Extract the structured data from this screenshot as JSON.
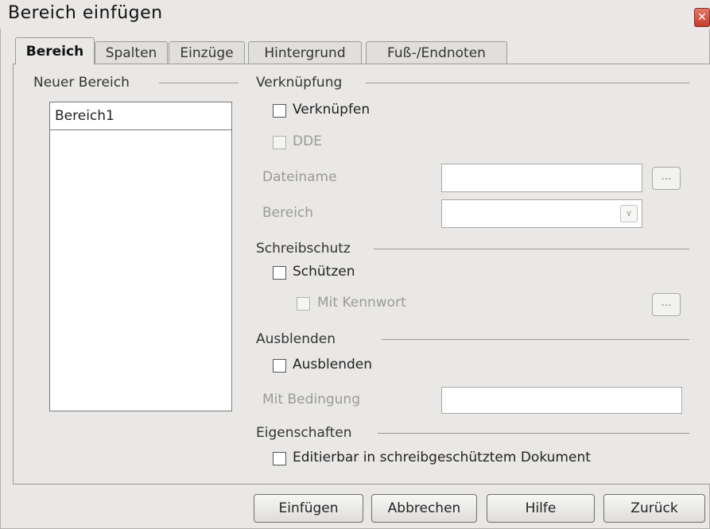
{
  "window": {
    "title": "Bereich einfügen",
    "close_glyph": "✕"
  },
  "tabs": [
    {
      "label": "Bereich",
      "active": true
    },
    {
      "label": "Spalten"
    },
    {
      "label": "Einzüge"
    },
    {
      "label": "Hintergrund"
    },
    {
      "label": "Fuß-/Endnoten"
    }
  ],
  "new_section": {
    "group_label": "Neuer Bereich",
    "name_value": "Bereich1"
  },
  "link": {
    "group_label": "Verknüpfung",
    "link_checkbox": "Verknüpfen",
    "dde_checkbox": "DDE",
    "filename_label": "Dateiname",
    "section_label": "Bereich",
    "browse_label": "..."
  },
  "write_protection": {
    "group_label": "Schreibschutz",
    "protect_checkbox": "Schützen",
    "password_checkbox": "Mit Kennwort",
    "password_button": "..."
  },
  "hide": {
    "group_label": "Ausblenden",
    "hide_checkbox": "Ausblenden",
    "condition_label": "Mit Bedingung"
  },
  "properties": {
    "group_label": "Eigenschaften",
    "editable_checkbox": "Editierbar in schreibgeschütztem Dokument"
  },
  "buttons": {
    "insert": "Einfügen",
    "cancel": "Abbrechen",
    "help": "Hilfe",
    "back": "Zurück"
  },
  "icons": {
    "dropdown": "chevron-down-icon",
    "close": "close-icon"
  }
}
